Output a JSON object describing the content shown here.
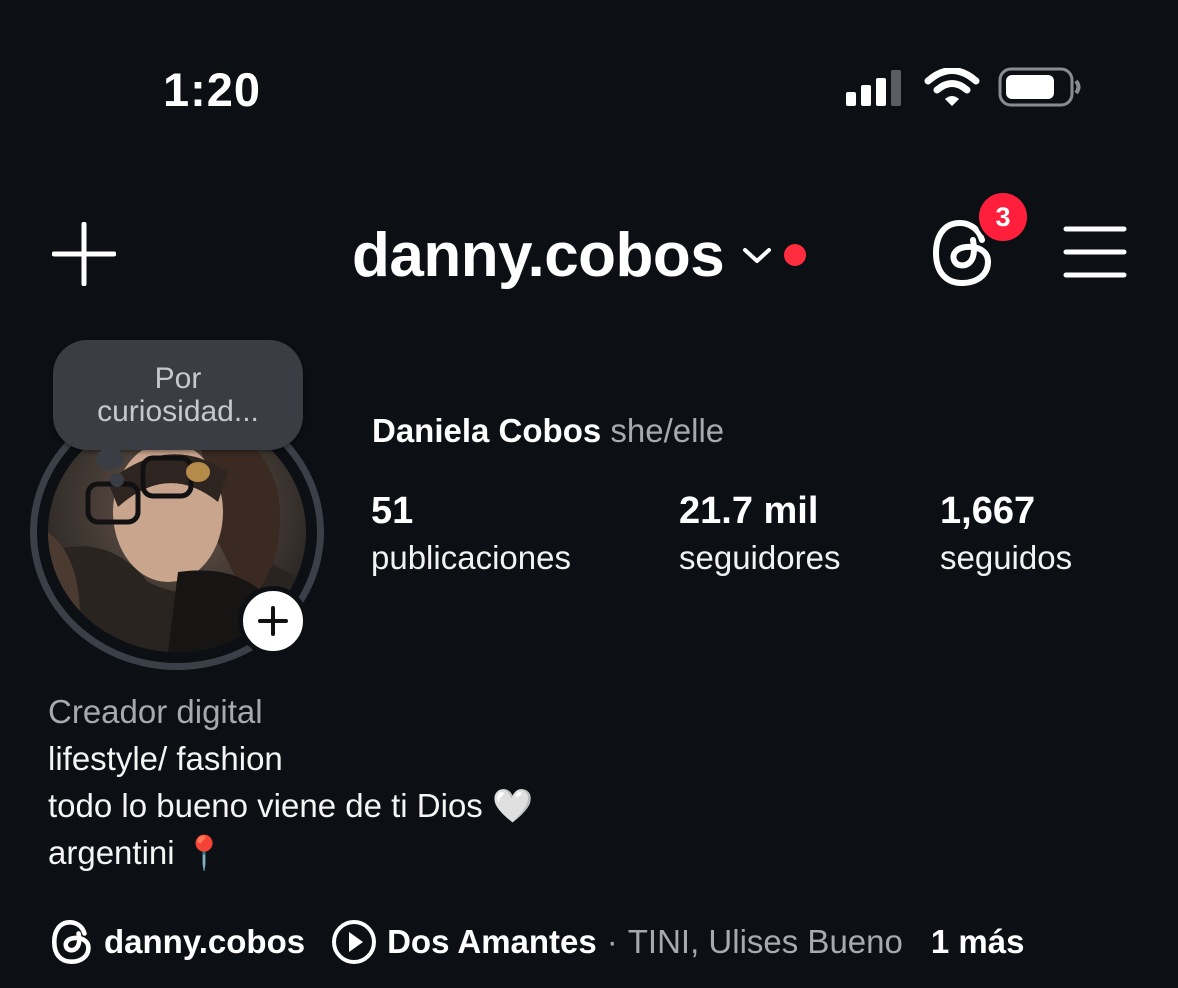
{
  "status_bar": {
    "time": "1:20",
    "icons": [
      "cellular-signal-icon",
      "wifi-icon",
      "battery-icon"
    ]
  },
  "header": {
    "create_icon": "plus-icon",
    "username": "danny.cobos",
    "switch_icon": "chevron-down-icon",
    "threads_icon": "threads-icon",
    "threads_badge_count": "3",
    "menu_icon": "hamburger-menu-icon"
  },
  "profile": {
    "note": [
      "Por",
      "curiosidad..."
    ],
    "full_name": "Daniela Cobos",
    "pronouns": "she/elle",
    "stats": [
      {
        "value": "51",
        "label": "publicaciones"
      },
      {
        "value": "21.7 mil",
        "label": "seguidores"
      },
      {
        "value": "1,667",
        "label": "seguidos"
      }
    ]
  },
  "bio": {
    "category": "Creador digital",
    "lines": [
      "lifestyle/ fashion",
      "todo lo bueno viene de ti Dios 🤍",
      "argentini 📍"
    ]
  },
  "links": {
    "threads_handle": "danny.cobos",
    "song_title": "Dos Amantes",
    "separator": "·",
    "song_artists": "TINI, Ulises Bueno",
    "more": "1 más"
  },
  "colors": {
    "background": "#0c0f14",
    "notification_red": "#ff1f3d",
    "secondary_text": "#a8a9ae"
  }
}
